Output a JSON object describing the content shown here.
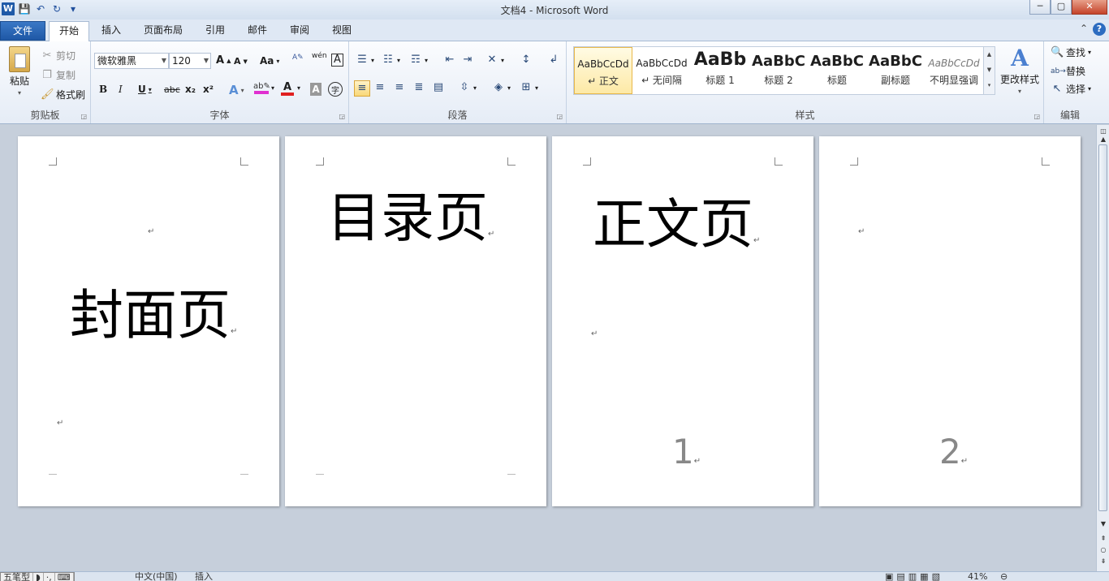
{
  "window": {
    "title": "文档4 - Microsoft Word",
    "minimize": "─",
    "maximize": "▢",
    "close": "✕"
  },
  "qat": {
    "logo": "W",
    "save": "💾",
    "undo": "↶",
    "redo": "↻",
    "customize": "▾"
  },
  "tabs": [
    {
      "label": "文件"
    },
    {
      "label": "开始"
    },
    {
      "label": "插入"
    },
    {
      "label": "页面布局"
    },
    {
      "label": "引用"
    },
    {
      "label": "邮件"
    },
    {
      "label": "审阅"
    },
    {
      "label": "视图"
    }
  ],
  "ribbon": {
    "clipboard": {
      "label": "剪贴板",
      "paste": "粘贴",
      "cut": "剪切",
      "copy": "复制",
      "format_painter": "格式刷"
    },
    "font": {
      "label": "字体",
      "font_name": "微软雅黑",
      "font_size": "120",
      "grow": "A",
      "shrink": "A",
      "change_case": "Aa",
      "bold": "B",
      "italic": "I",
      "underline": "U",
      "strikethrough": "abc",
      "subscript": "x₂",
      "superscript": "x²",
      "font_color": "A",
      "char_border": "A",
      "phonetic": "wén",
      "enclose": "字"
    },
    "paragraph": {
      "label": "段落"
    },
    "styles": {
      "label": "样式",
      "items": [
        {
          "sample": "AaBbCcDd",
          "name": "↵ 正文"
        },
        {
          "sample": "AaBbCcDd",
          "name": "↵ 无间隔"
        },
        {
          "sample": "AaBb",
          "name": "标题 1"
        },
        {
          "sample": "AaBbC",
          "name": "标题 2"
        },
        {
          "sample": "AaBbC",
          "name": "标题"
        },
        {
          "sample": "AaBbC",
          "name": "副标题"
        },
        {
          "sample": "AaBbCcDd",
          "name": "不明显强调"
        }
      ],
      "change_styles": "更改样式"
    },
    "editing": {
      "label": "编辑",
      "find": "查找",
      "replace": "替换",
      "select": "选择"
    }
  },
  "pages": [
    {
      "text": "封面页"
    },
    {
      "text": "目录页"
    },
    {
      "text": "正文页",
      "page_number": "1"
    },
    {
      "text": "",
      "page_number": "2"
    }
  ],
  "paragraph_mark": "↵",
  "statusbar": {
    "ime_name": "五笔型",
    "language": "中文(中国)",
    "insert_mode": "插入",
    "zoom": "41%"
  }
}
